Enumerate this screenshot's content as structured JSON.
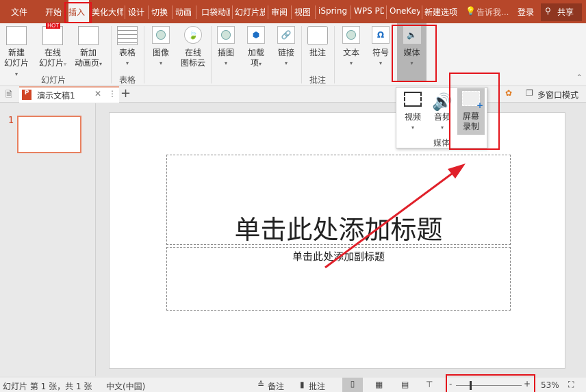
{
  "tabs": [
    "文件",
    "开始",
    "插入",
    "美化大师",
    "设计",
    "切换",
    "动画",
    "口袋动画",
    "幻灯片放",
    "审阅",
    "视图",
    "iSpring",
    "WPS PD",
    "OneKey",
    "新建选项"
  ],
  "tell_me": "告诉我...",
  "login": "登录",
  "share": "共享",
  "ribbon": {
    "new_slide": [
      "新建",
      "幻灯片"
    ],
    "online_slide": [
      "在线",
      "幻灯片"
    ],
    "new_anim": [
      "新加",
      "动画页"
    ],
    "hot": "HOT",
    "group_slides": "幻灯片",
    "table": "表格",
    "group_table": "表格",
    "image": "图像",
    "icon_cloud": [
      "在线",
      "图标云"
    ],
    "illustration": "插图",
    "addins": [
      "加载",
      "项"
    ],
    "link": "链接",
    "comment": "批注",
    "group_comment": "批注",
    "text": "文本",
    "symbol": "符号",
    "media": "媒体"
  },
  "media_popup": {
    "video": "视频",
    "audio": "音频",
    "screen_rec": [
      "屏幕",
      "录制"
    ],
    "group": "媒体"
  },
  "docbar": {
    "doc_tab": "演示文稿1",
    "multiwindow": "多窗口模式"
  },
  "slide": {
    "number": "1",
    "title": "单击此处添加标题",
    "subtitle": "单击此处添加副标题"
  },
  "status": {
    "slide_info": "幻灯片 第 1 张，共 1 张",
    "language": "中文(中国)",
    "notes": "备注",
    "comments": "批注",
    "zoom": "53%"
  },
  "colors": {
    "accent": "#b7472a",
    "highlight": "#e3141b",
    "arrow": "#e0202a"
  }
}
